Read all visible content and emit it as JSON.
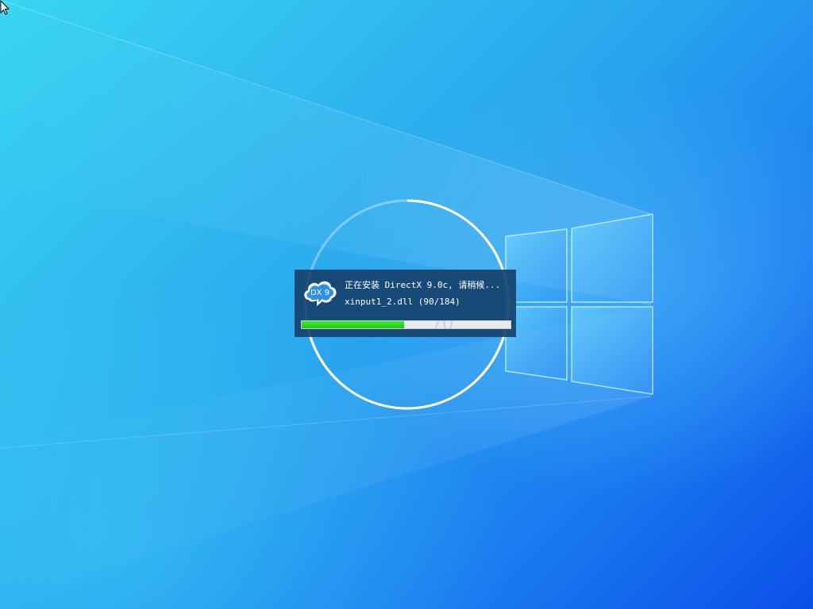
{
  "installer": {
    "logo_text": "DX 9",
    "title": "正在安装 DirectX 9.0c, 请稍候...",
    "file_status": "xinput1_2.dll (90/184)",
    "progress": {
      "current": 90,
      "total": 184
    },
    "ghost_percent": "70"
  },
  "colors": {
    "panel": "#16426e",
    "progress_fill": "#2ee01c",
    "progress_track": "#e8eaec",
    "ring": "#ffffff"
  },
  "icons": {
    "logo": "dx9-cloud-logo",
    "cursor": "mouse-pointer-icon"
  }
}
